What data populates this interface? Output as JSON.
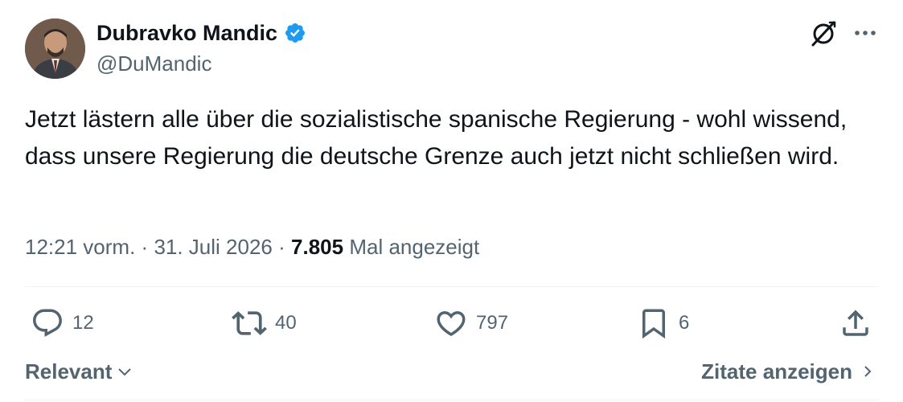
{
  "author": {
    "name": "Dubravko Mandic",
    "handle": "@DuMandic",
    "verified": true
  },
  "tweet": {
    "text": "Jetzt lästern alle über die sozialistische spanische Regierung - wohl wissend, dass unsere Regierung die deutsche Grenze auch jetzt nicht schließen wird."
  },
  "meta": {
    "time": "12:21 vorm.",
    "separator": "·",
    "date": "31. Juli 2026",
    "views_count": "7.805",
    "views_label": "Mal angezeigt"
  },
  "actions": {
    "replies": "12",
    "reposts": "40",
    "likes": "797",
    "bookmarks": "6"
  },
  "footer": {
    "sort_label": "Relevant",
    "quotes_label": "Zitate anzeigen"
  },
  "icons": {
    "verified": "verified-badge-icon",
    "grok": "grok-icon",
    "more": "more-options-icon",
    "reply": "reply-icon",
    "repost": "repost-icon",
    "like": "like-icon",
    "bookmark": "bookmark-icon",
    "share": "share-icon",
    "chevron_down": "chevron-down-icon",
    "chevron_right": "chevron-right-icon"
  },
  "colors": {
    "text_primary": "#0f1419",
    "text_secondary": "#536471",
    "verified_blue": "#1d9bf0",
    "divider": "#eff3f4",
    "background": "#ffffff"
  }
}
